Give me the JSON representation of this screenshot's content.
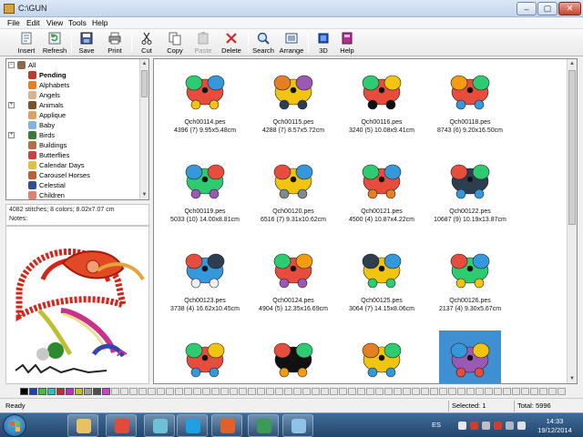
{
  "window": {
    "title": "C:\\GUN"
  },
  "caption_buttons": {
    "minimize": "–",
    "maximize": "▢",
    "close": "✕"
  },
  "menu": [
    "File",
    "Edit",
    "View",
    "Tools",
    "Help"
  ],
  "toolbar": [
    {
      "label": "Insert",
      "icon": "insert-icon",
      "enabled": true
    },
    {
      "label": "Refresh",
      "icon": "refresh-icon",
      "enabled": true
    },
    {
      "label": "Save",
      "icon": "save-icon",
      "enabled": true
    },
    {
      "label": "Print",
      "icon": "print-icon",
      "enabled": true
    },
    {
      "label": "Cut",
      "icon": "cut-icon",
      "enabled": true
    },
    {
      "label": "Copy",
      "icon": "copy-icon",
      "enabled": true
    },
    {
      "label": "Paste",
      "icon": "paste-icon",
      "enabled": false
    },
    {
      "label": "Delete",
      "icon": "delete-icon",
      "enabled": true
    },
    {
      "label": "Search",
      "icon": "search-icon",
      "enabled": true
    },
    {
      "label": "Arrange",
      "icon": "arrange-icon",
      "enabled": true
    },
    {
      "label": "3D",
      "icon": "3d-icon",
      "enabled": true
    },
    {
      "label": "Help",
      "icon": "help-book-icon",
      "enabled": true
    }
  ],
  "tree": [
    {
      "label": "All",
      "level": 0,
      "expander": "−",
      "icon": "folder-icon",
      "color": "#8a6a4a"
    },
    {
      "label": "Pending",
      "level": 1,
      "expander": "",
      "icon": "pending-icon",
      "color": "#c0392b",
      "selected": true
    },
    {
      "label": "Alphabets",
      "level": 1,
      "expander": "",
      "icon": "alphabets-icon",
      "color": "#e67e22"
    },
    {
      "label": "Angels",
      "level": 1,
      "expander": "",
      "icon": "angel-icon",
      "color": "#d9b38c"
    },
    {
      "label": "Animals",
      "level": 1,
      "expander": "+",
      "icon": "animal-icon",
      "color": "#7a5230"
    },
    {
      "label": "Applique",
      "level": 1,
      "expander": "",
      "icon": "applique-icon",
      "color": "#e0a060"
    },
    {
      "label": "Baby",
      "level": 1,
      "expander": "",
      "icon": "baby-icon",
      "color": "#7fb3e0"
    },
    {
      "label": "Birds",
      "level": 1,
      "expander": "+",
      "icon": "bird-icon",
      "color": "#3a7a3a"
    },
    {
      "label": "Buildings",
      "level": 1,
      "expander": "",
      "icon": "building-icon",
      "color": "#b07040"
    },
    {
      "label": "Butterflies",
      "level": 1,
      "expander": "",
      "icon": "butterfly-icon",
      "color": "#d04040"
    },
    {
      "label": "Calendar Days",
      "level": 1,
      "expander": "",
      "icon": "calendar-icon",
      "color": "#e0c040"
    },
    {
      "label": "Carousel Horses",
      "level": 1,
      "expander": "",
      "icon": "horse-icon",
      "color": "#c06030"
    },
    {
      "label": "Celestial",
      "level": 1,
      "expander": "",
      "icon": "celestial-icon",
      "color": "#305090"
    },
    {
      "label": "Children",
      "level": 1,
      "expander": "",
      "icon": "children-icon",
      "color": "#e08070"
    }
  ],
  "info": {
    "summary": "4082 stitches; 8 colors; 8.02x7.07 cm",
    "notes_label": "Notes:"
  },
  "designs": [
    {
      "name": "Qch00114.pes",
      "info": "4396 (7) 9.95x5.48cm",
      "icon": "design-thumb-icon",
      "colors": [
        "#e74c3c",
        "#2ecc71",
        "#3498db",
        "#f1c40f"
      ]
    },
    {
      "name": "Qch00115.pes",
      "info": "4288 (7) 8.57x5.72cm",
      "icon": "design-thumb-icon",
      "colors": [
        "#f1c40f",
        "#e67e22",
        "#9b59b6",
        "#2c3e50"
      ]
    },
    {
      "name": "Qch00116.pes",
      "info": "3240 (5) 10.08x9.41cm",
      "icon": "design-thumb-icon",
      "colors": [
        "#e74c3c",
        "#2ecc71",
        "#f1c40f",
        "#111111"
      ]
    },
    {
      "name": "Qch00118.pes",
      "info": "8743 (6) 9.20x16.50cm",
      "icon": "design-thumb-icon",
      "colors": [
        "#e74c3c",
        "#f39c12",
        "#2ecc71",
        "#3498db"
      ]
    },
    {
      "name": "Qch00119.pes",
      "info": "5033 (10) 14.00x8.81cm",
      "icon": "design-thumb-icon",
      "colors": [
        "#2ecc71",
        "#3498db",
        "#e74c3c",
        "#9b59b6"
      ]
    },
    {
      "name": "Qch00120.pes",
      "info": "6516 (7) 9.31x10.62cm",
      "icon": "design-thumb-icon",
      "colors": [
        "#f1c40f",
        "#e74c3c",
        "#3498db",
        "#7f8c8d"
      ]
    },
    {
      "name": "Qch00121.pes",
      "info": "4500 (4) 10.87x4.22cm",
      "icon": "design-thumb-icon",
      "colors": [
        "#e74c3c",
        "#2ecc71",
        "#3498db",
        "#e67e22"
      ]
    },
    {
      "name": "Qch00122.pes",
      "info": "10687 (9) 10.19x13.87cm",
      "icon": "design-thumb-icon",
      "colors": [
        "#2c3e50",
        "#e74c3c",
        "#2ecc71",
        "#3498db"
      ]
    },
    {
      "name": "Qch00123.pes",
      "info": "3738 (4) 16.62x10.45cm",
      "icon": "design-thumb-icon",
      "colors": [
        "#3498db",
        "#e74c3c",
        "#2c3e50",
        "#ecf0f1"
      ]
    },
    {
      "name": "Qch00124.pes",
      "info": "4904 (5) 12.35x16.69cm",
      "icon": "design-thumb-icon",
      "colors": [
        "#e74c3c",
        "#2ecc71",
        "#f39c12",
        "#9b59b6"
      ]
    },
    {
      "name": "Qch00125.pes",
      "info": "3064 (7) 14.15x8.06cm",
      "icon": "design-thumb-icon",
      "colors": [
        "#f1c40f",
        "#2c3e50",
        "#3498db",
        "#2ecc71"
      ]
    },
    {
      "name": "Qch00126.pes",
      "info": "2137 (4) 9.30x5.67cm",
      "icon": "design-thumb-icon",
      "colors": [
        "#2ecc71",
        "#e74c3c",
        "#3498db",
        "#f1c40f"
      ]
    },
    {
      "name": "",
      "info": "",
      "icon": "design-thumb-icon",
      "colors": [
        "#e74c3c",
        "#2ecc71",
        "#f1c40f",
        "#3498db"
      ]
    },
    {
      "name": "",
      "info": "",
      "icon": "design-thumb-icon",
      "colors": [
        "#111111",
        "#e74c3c",
        "#2ecc71",
        "#f39c12"
      ]
    },
    {
      "name": "",
      "info": "",
      "icon": "design-thumb-icon",
      "colors": [
        "#f1c40f",
        "#e67e22",
        "#2ecc71",
        "#3498db"
      ]
    },
    {
      "name": "",
      "info": "",
      "icon": "design-thumb-icon",
      "colors": [
        "#9b59b6",
        "#3498db",
        "#f1c40f",
        "#e74c3c"
      ],
      "selected": true
    }
  ],
  "palette": [
    "#000000",
    "#1f3fbf",
    "#3fbf3f",
    "#2fbfbf",
    "#bf2f2f",
    "#bf2fbf",
    "#bfbf2f",
    "#9f9f9f",
    "#4f4f4f",
    "#cf3fcf"
  ],
  "status": {
    "left": "Ready",
    "selected": "Selected: 1",
    "total": "Total: 5996"
  },
  "taskbar": {
    "apps": [
      {
        "icon": "explorer-icon",
        "color": "#e8c262"
      },
      {
        "icon": "chrome-icon",
        "color": "#e24a3a"
      },
      {
        "icon": "app-icon",
        "color": "#6cc1d6"
      },
      {
        "icon": "skype-icon",
        "color": "#1fa0e0"
      },
      {
        "icon": "flame-icon",
        "color": "#e0602a"
      },
      {
        "icon": "embroidery-app-icon",
        "color": "#3b9a55"
      },
      {
        "icon": "paint-icon",
        "color": "#8ec2e8"
      }
    ],
    "language": "ES",
    "time": "14:33",
    "date": "19/12/2014"
  }
}
